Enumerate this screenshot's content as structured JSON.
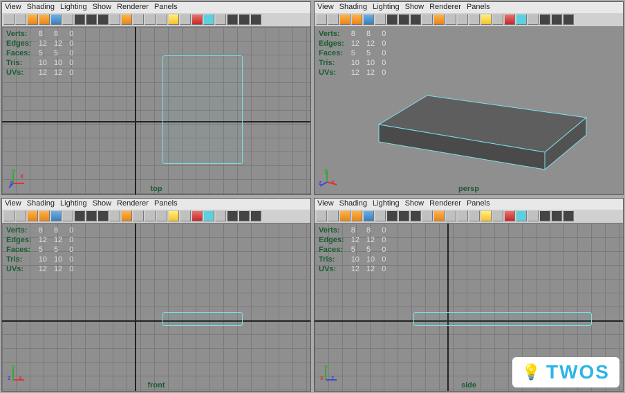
{
  "menus": [
    "View",
    "Shading",
    "Lighting",
    "Show",
    "Renderer",
    "Panels"
  ],
  "stats": {
    "labels": [
      "Verts:",
      "Edges:",
      "Faces:",
      "Tris:",
      "UVs:"
    ],
    "cols": [
      [
        "8",
        "12",
        "5",
        "10",
        "12"
      ],
      [
        "8",
        "12",
        "5",
        "10",
        "12"
      ],
      [
        "0",
        "0",
        "0",
        "0",
        "0"
      ]
    ]
  },
  "views": {
    "top": "top",
    "persp": "persp",
    "front": "front",
    "side": "side"
  },
  "gizmo": {
    "x": "x",
    "y": "y",
    "z": "z"
  },
  "watermark": {
    "text": "TWOS",
    "icon": "💡"
  },
  "toolbar_icons": [
    {
      "name": "select-icon",
      "cls": ""
    },
    {
      "name": "lasso-icon",
      "cls": ""
    },
    {
      "name": "camera-icon",
      "cls": "orange"
    },
    {
      "name": "shading-icon",
      "cls": "orange"
    },
    {
      "name": "shading2-icon",
      "cls": "blue"
    },
    {
      "name": "smooth-icon",
      "cls": ""
    },
    {
      "name": "wire-icon",
      "cls": "dark"
    },
    {
      "name": "wire2-icon",
      "cls": "dark"
    },
    {
      "name": "tex-icon",
      "cls": "dark"
    },
    {
      "name": "xray-icon",
      "cls": ""
    },
    {
      "name": "box-icon",
      "cls": "orange"
    },
    {
      "name": "iso-icon",
      "cls": ""
    },
    {
      "name": "iso2-icon",
      "cls": ""
    },
    {
      "name": "iso3-icon",
      "cls": ""
    },
    {
      "name": "light-icon",
      "cls": "yellow"
    },
    {
      "name": "shadow-icon",
      "cls": ""
    },
    {
      "name": "hq-icon",
      "cls": "red"
    },
    {
      "name": "frame-icon",
      "cls": "cyan"
    },
    {
      "name": "grid-icon",
      "cls": ""
    },
    {
      "name": "film-icon",
      "cls": "dark"
    },
    {
      "name": "res-icon",
      "cls": "dark"
    },
    {
      "name": "gate-icon",
      "cls": "dark"
    }
  ]
}
